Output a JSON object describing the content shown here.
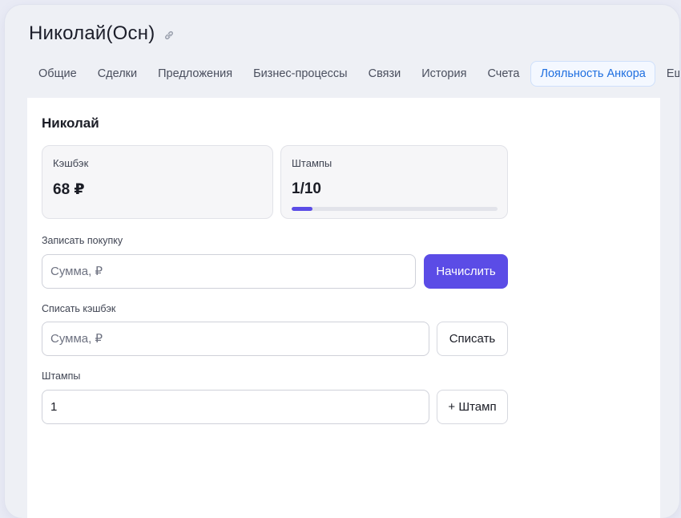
{
  "header": {
    "title": "Николай(Осн)",
    "link_icon": "link-icon"
  },
  "tabs": [
    {
      "label": "Общие",
      "active": false
    },
    {
      "label": "Сделки",
      "active": false
    },
    {
      "label": "Предложения",
      "active": false
    },
    {
      "label": "Бизнес-процессы",
      "active": false
    },
    {
      "label": "Связи",
      "active": false
    },
    {
      "label": "История",
      "active": false
    },
    {
      "label": "Счета",
      "active": false
    },
    {
      "label": "Лояльность Анкора",
      "active": true
    }
  ],
  "more_tab": {
    "label": "Еще",
    "icon": "chevron-down-icon"
  },
  "profile": {
    "name": "Николай"
  },
  "cashback": {
    "label": "Кэшбэк",
    "value": "68 ₽"
  },
  "stamps_card": {
    "label": "Штампы",
    "value": "1/10",
    "progress_fraction": 0.1
  },
  "record_purchase": {
    "label": "Записать покупку",
    "placeholder": "Сумма, ₽",
    "value": "",
    "button_label": "Начислить"
  },
  "write_off": {
    "label": "Списать кэшбэк",
    "placeholder": "Сумма, ₽",
    "value": "",
    "button_label": "Списать"
  },
  "stamps_input": {
    "label": "Штампы",
    "value": "1",
    "button_label": "+ Штамп"
  },
  "colors": {
    "accent": "#5b4ce6",
    "active_tab": "#1f6fe0"
  }
}
